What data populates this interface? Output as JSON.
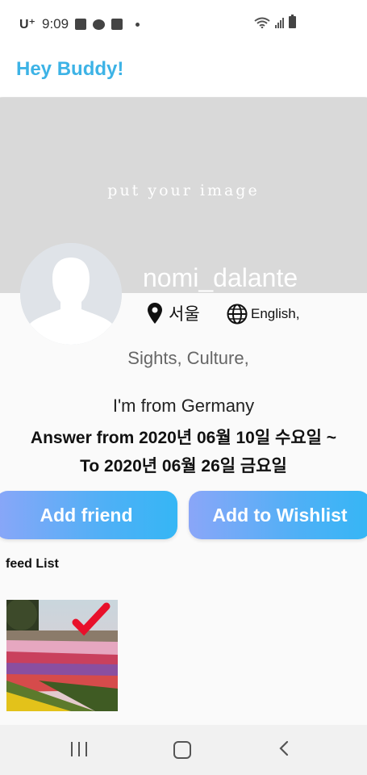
{
  "status_bar": {
    "carrier": "U⁺",
    "time": "9:09",
    "icons": [
      "gallery-icon",
      "talk-icon",
      "twitch-icon",
      "dot-icon",
      "wifi-icon",
      "signal-icon",
      "battery-icon"
    ]
  },
  "app_bar": {
    "title": "Hey Buddy!",
    "title_color": "#3db3e6"
  },
  "cover": {
    "placeholder": "put your image",
    "bg_color": "#d9d9d9"
  },
  "profile": {
    "username": "nomi_dalante",
    "location": "서울",
    "language": "English,",
    "interests": "Sights,  Culture,",
    "origin": "I'm from Germany",
    "answer_from": "Answer from  2020년 06월  10일 수요일 ~",
    "answer_to": "To  2020년 06월  26일 금요일"
  },
  "actions": {
    "add_friend": "Add friend",
    "add_wishlist": "Add to Wishlist",
    "gradient_start": "#8aa6f8",
    "gradient_end": "#35b6f5"
  },
  "feed": {
    "label": "feed List",
    "items": [
      {
        "icon": "flower-field-photo",
        "badge": "check-icon",
        "badge_color": "#e8102a"
      }
    ]
  },
  "nav": {
    "icons": [
      "recent-apps-icon",
      "home-icon",
      "back-icon"
    ]
  }
}
